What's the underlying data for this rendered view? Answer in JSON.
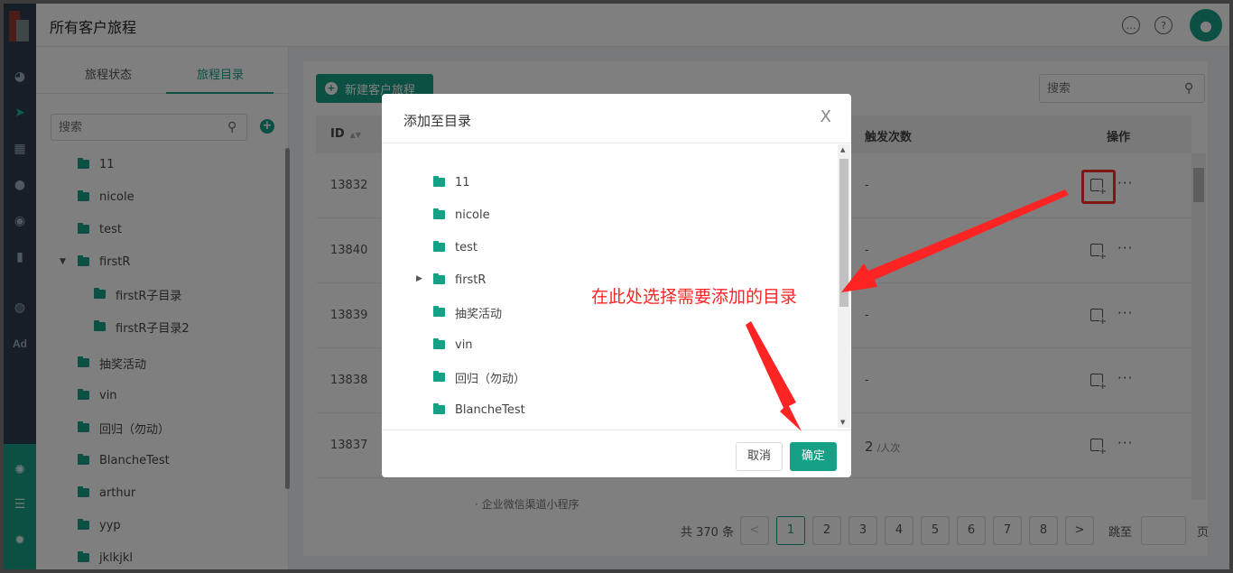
{
  "header": {
    "title": "所有客户旅程",
    "message_icon": "chat-icon",
    "help_icon": "help-icon",
    "help_glyph": "?",
    "avatar_icon": "user-icon"
  },
  "rail": {
    "ad_label": "Ad"
  },
  "left_panel": {
    "tabs": [
      {
        "label": "旅程状态",
        "active": false
      },
      {
        "label": "旅程目录",
        "active": true
      }
    ],
    "search_placeholder": "搜索",
    "add_glyph": "+",
    "tree": [
      {
        "label": "11",
        "level": 0
      },
      {
        "label": "nicole",
        "level": 0
      },
      {
        "label": "test",
        "level": 0
      },
      {
        "label": "firstR",
        "level": 0,
        "expanded": true
      },
      {
        "label": "firstR子目录",
        "level": 1
      },
      {
        "label": "firstR子目录2",
        "level": 1
      },
      {
        "label": "抽奖活动",
        "level": 0
      },
      {
        "label": "vin",
        "level": 0
      },
      {
        "label": "回归（勿动）",
        "level": 0
      },
      {
        "label": "BlancheTest",
        "level": 0
      },
      {
        "label": "arthur",
        "level": 0
      },
      {
        "label": "yyp",
        "level": 0
      },
      {
        "label": "jklkjkl",
        "level": 0
      }
    ]
  },
  "main": {
    "new_button": "新建客户旅程",
    "new_button_glyph": "+",
    "search_placeholder": "搜索",
    "columns": {
      "id": "ID",
      "trigger": "触发次数",
      "ops": "操作"
    },
    "rows": [
      {
        "id": "13832",
        "trigger": "-",
        "trigger_unit": ""
      },
      {
        "id": "13840",
        "trigger": "-",
        "trigger_unit": ""
      },
      {
        "id": "13839",
        "trigger": "-",
        "trigger_unit": ""
      },
      {
        "id": "13838",
        "trigger": "-",
        "trigger_unit": ""
      },
      {
        "id": "13837",
        "trigger": "2",
        "trigger_unit": "/人次"
      }
    ],
    "more_glyph": "···",
    "peek_text": "· 企业微信渠道小程序",
    "pagination": {
      "total": "共 370 条",
      "prev": "<",
      "next": ">",
      "pages": [
        "1",
        "2",
        "3",
        "4",
        "5",
        "6",
        "7",
        "8"
      ],
      "current": "1",
      "jump_label": "跳至",
      "unit": "页"
    }
  },
  "dialog": {
    "title": "添加至目录",
    "close_glyph": "X",
    "tree": [
      {
        "label": "11",
        "has_children": false
      },
      {
        "label": "nicole",
        "has_children": false
      },
      {
        "label": "test",
        "has_children": false
      },
      {
        "label": "firstR",
        "has_children": true
      },
      {
        "label": "抽奖活动",
        "has_children": false
      },
      {
        "label": "vin",
        "has_children": false
      },
      {
        "label": "回归（勿动）",
        "has_children": false
      },
      {
        "label": "BlancheTest",
        "has_children": false
      }
    ],
    "cancel": "取消",
    "confirm": "确定"
  },
  "annotation": {
    "text": "在此处选择需要添加的目录",
    "color": "#ff2424"
  },
  "colors": {
    "accent": "#16a085",
    "rail": "#2c3e50",
    "highlight": "#ff2d2d"
  }
}
